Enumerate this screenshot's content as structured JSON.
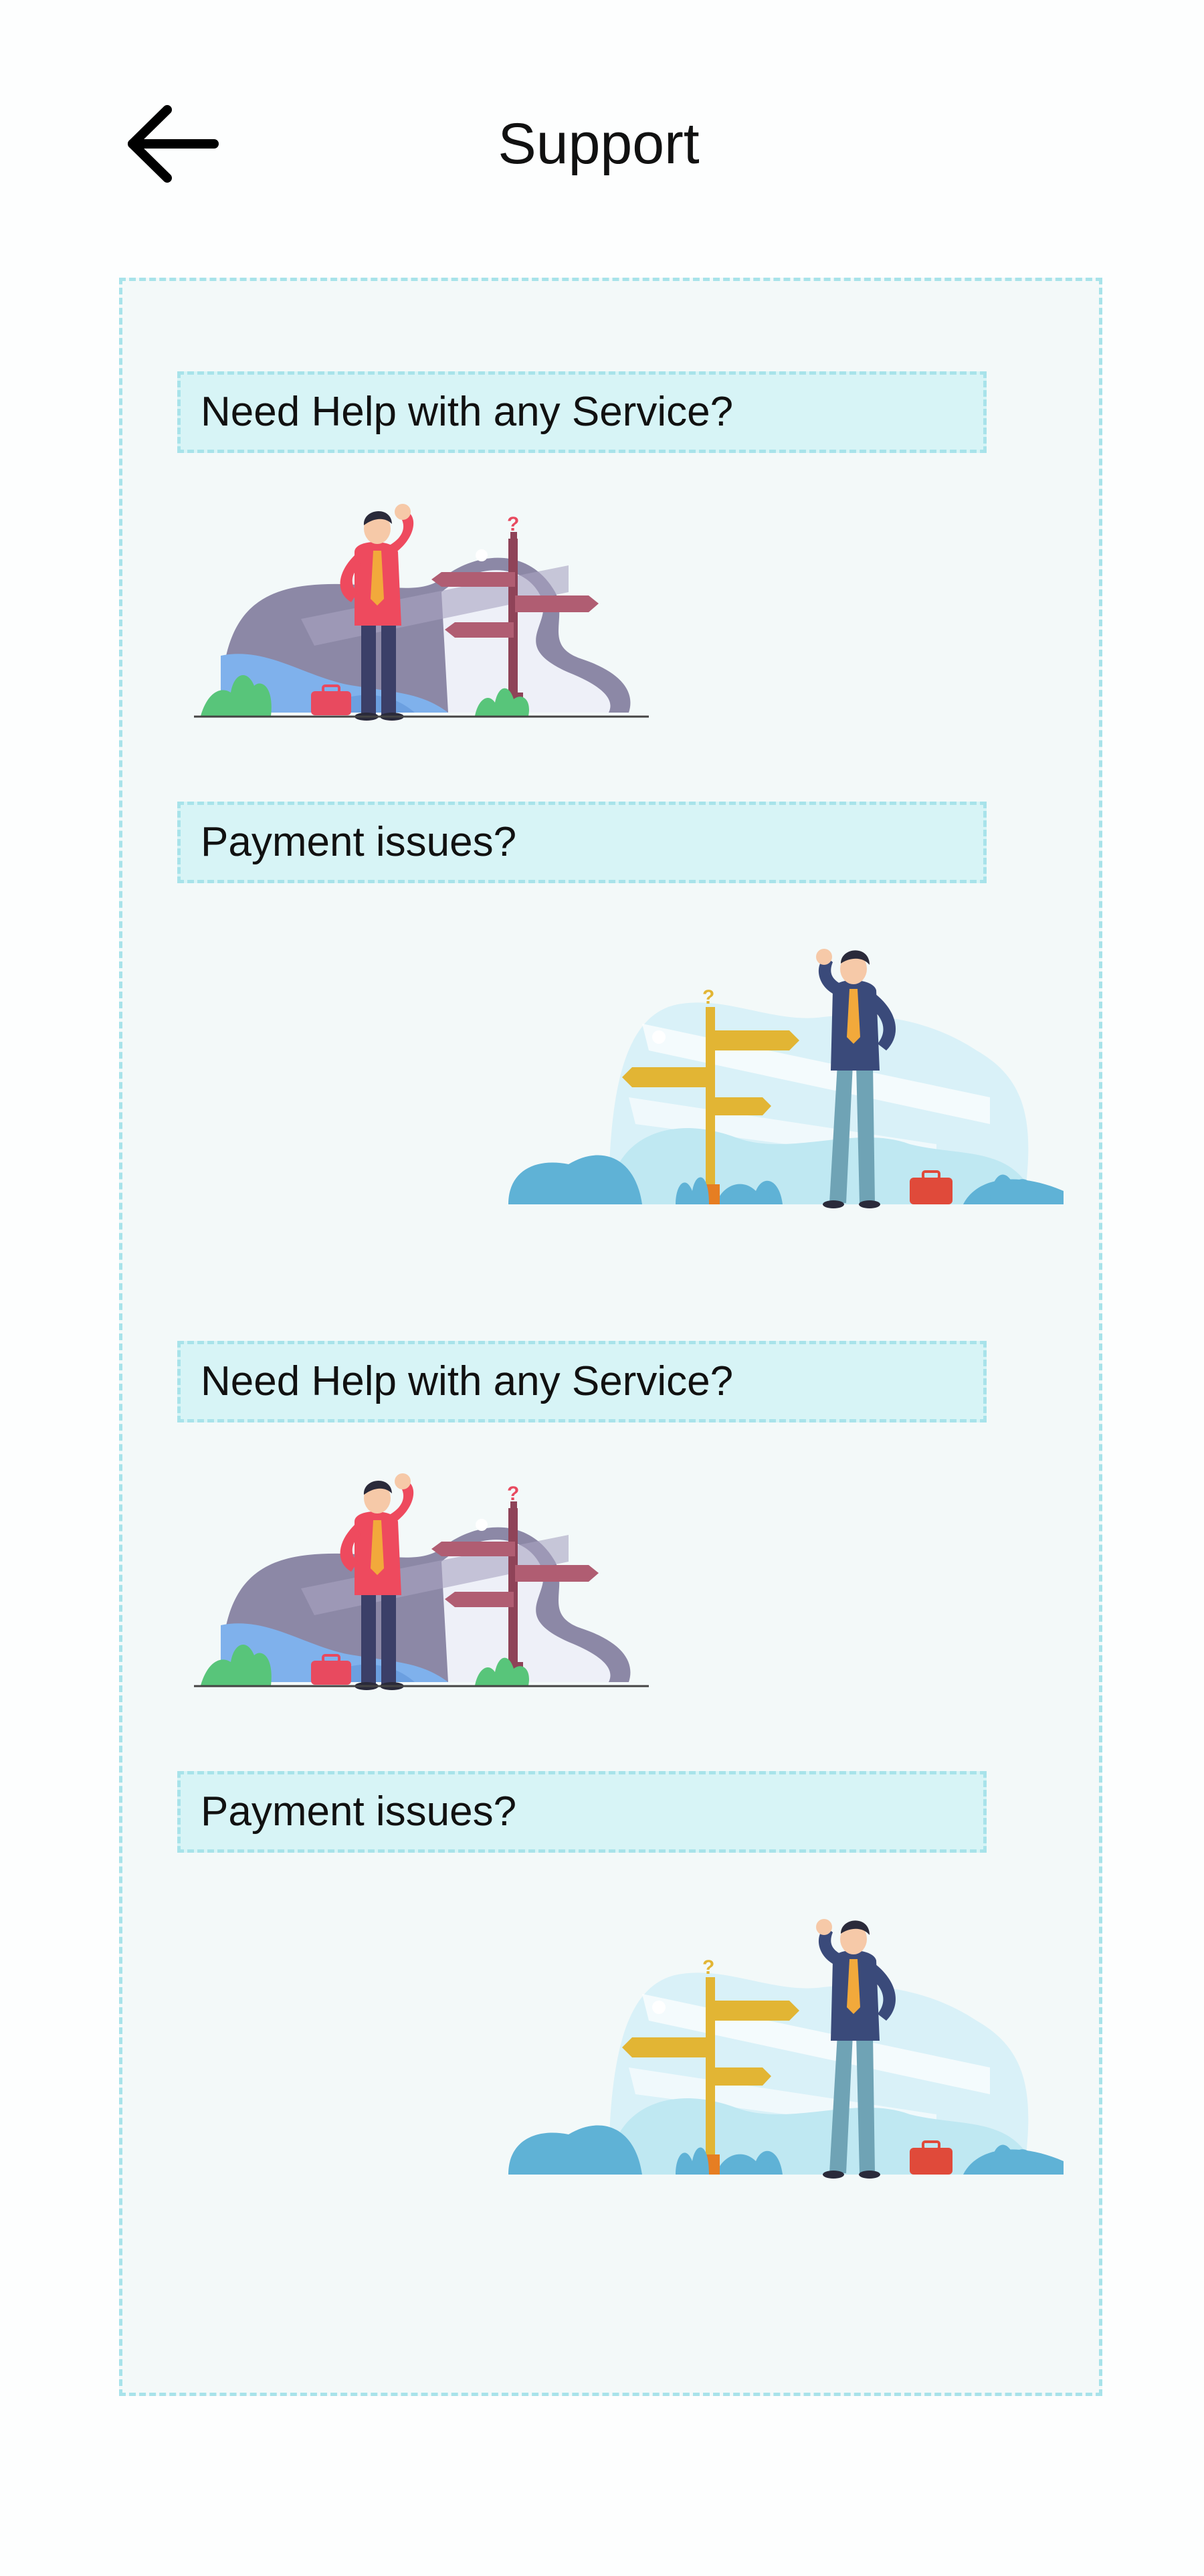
{
  "header": {
    "title": "Support",
    "back_icon": "arrow-left-icon"
  },
  "sections": [
    {
      "heading": "Need Help with any Service?",
      "illustration": "confused-man-signpost-red-illustration"
    },
    {
      "heading": "Payment issues?",
      "illustration": "confused-man-signpost-yellow-illustration"
    },
    {
      "heading": "Need Help with any Service?",
      "illustration": "confused-man-signpost-red-illustration"
    },
    {
      "heading": "Payment issues?",
      "illustration": "confused-man-signpost-yellow-illustration"
    }
  ],
  "colors": {
    "panel_background": "#f3f9f9",
    "panel_border": "#a8e3ea",
    "heading_background": "#d7f4f6"
  }
}
